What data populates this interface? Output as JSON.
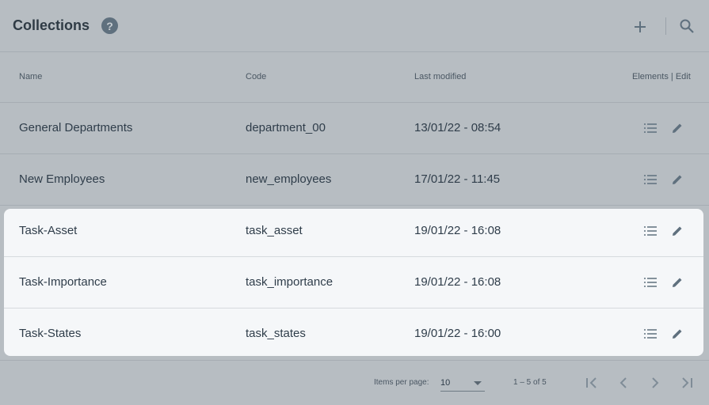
{
  "header": {
    "title": "Collections",
    "help_symbol": "?",
    "icons": [
      "help-icon",
      "add-icon",
      "search-icon"
    ]
  },
  "table": {
    "columns": {
      "name": "Name",
      "code": "Code",
      "last_modified": "Last modified",
      "actions": "Elements | Edit"
    },
    "rows": [
      {
        "name": "General Departments",
        "code": "department_00",
        "modified": "13/01/22 - 08:54",
        "highlighted": false
      },
      {
        "name": "New Employees",
        "code": "new_employees",
        "modified": "17/01/22 - 11:45",
        "highlighted": false
      },
      {
        "name": "Task-Asset",
        "code": "task_asset",
        "modified": "19/01/22 - 16:08",
        "highlighted": true
      },
      {
        "name": "Task-Importance",
        "code": "task_importance",
        "modified": "19/01/22 - 16:08",
        "highlighted": true
      },
      {
        "name": "Task-States",
        "code": "task_states",
        "modified": "19/01/22 - 16:00",
        "highlighted": true
      }
    ],
    "row_icons": [
      "list-icon",
      "edit-icon"
    ]
  },
  "paginator": {
    "items_per_page_label": "Items per page:",
    "items_per_page_value": "10",
    "range_label": "1 – 5 of 5",
    "icons": [
      "first-page-icon",
      "prev-page-icon",
      "next-page-icon",
      "last-page-icon"
    ]
  },
  "colors": {
    "overlay_background": "#b7bdc2",
    "highlight_background": "#f5f7f9",
    "text": "#2f3d4a",
    "icon": "#5f707e"
  }
}
